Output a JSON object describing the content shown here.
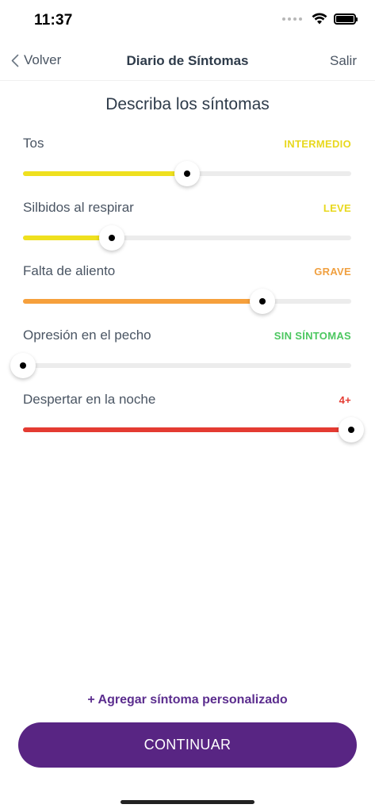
{
  "status_bar": {
    "time": "11:37"
  },
  "nav": {
    "back_label": "Volver",
    "title": "Diario de Síntomas",
    "exit_label": "Salir"
  },
  "section_title": "Describa los síntomas",
  "symptoms": [
    {
      "label": "Tos",
      "level": "INTERMEDIO",
      "level_color": "#e8d81e",
      "fill_color": "#efe01e",
      "value_fraction": 0.5
    },
    {
      "label": "Silbidos al respirar",
      "level": "LEVE",
      "level_color": "#e8d81e",
      "fill_color": "#efe01e",
      "value_fraction": 0.27
    },
    {
      "label": "Falta de aliento",
      "level": "GRAVE",
      "level_color": "#f0a040",
      "fill_color": "#f6a03c",
      "value_fraction": 0.73
    },
    {
      "label": "Opresión en el pecho",
      "level": "SIN SÍNTOMAS",
      "level_color": "#4cc760",
      "fill_color": "#4cc760",
      "value_fraction": 0.0
    },
    {
      "label": "Despertar en la noche",
      "level": "4+",
      "level_color": "#e43b32",
      "fill_color": "#e43b32",
      "value_fraction": 1.0
    }
  ],
  "add_symptom_label": "+ Agregar síntoma personalizado",
  "continue_label": "CONTINUAR",
  "colors": {
    "primary": "#582583",
    "link": "#5b2d8e"
  }
}
